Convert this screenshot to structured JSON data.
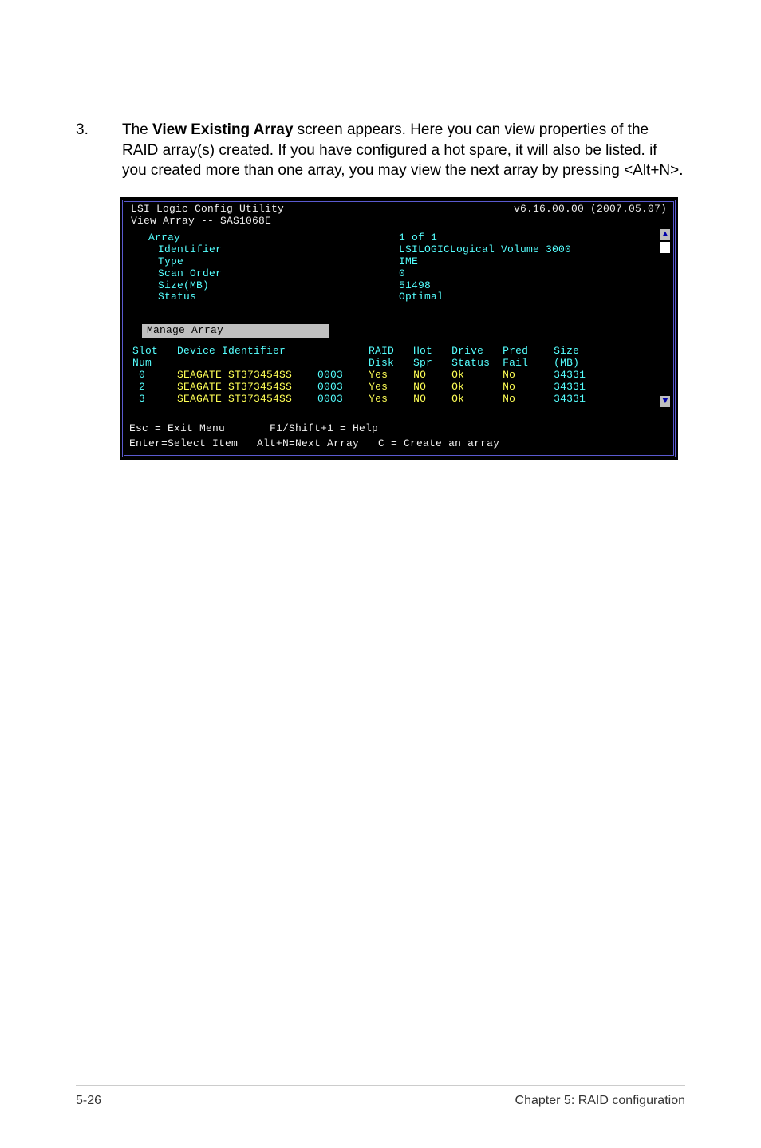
{
  "step": {
    "number": "3.",
    "prefix": "The ",
    "bold": "View Existing Array",
    "suffix": " screen appears. Here you can view properties of the RAID array(s) created. If you have configured a hot spare, it will also be listed. if you created more than one array, you may view the next array by pressing <Alt+N>."
  },
  "terminal": {
    "title_line1": "LSI Logic Config Utility",
    "title_line2": "View Array -- SAS1068E",
    "version": "v6.16.00.00 (2007.05.07)",
    "labels": {
      "array": "Array",
      "identifier": "Identifier",
      "type": "Type",
      "scan_order": "Scan Order",
      "size": "Size(MB)",
      "status": "Status"
    },
    "values": {
      "array": "1 of 1",
      "identifier": "LSILOGICLogical Volume  3000",
      "type": "IME",
      "scan_order": "0",
      "size": "51498",
      "status": "Optimal"
    },
    "selected": "Manage Array",
    "table_header_l1": "Slot   Device Identifier             RAID   Hot   Drive   Pred    Size",
    "table_header_l2": "Num                                  Disk   Spr   Status  Fail    (MB)",
    "rows": [
      {
        "slot": " 0",
        "dev": "SEAGATE ST373454SS",
        "code": "0003",
        "raid": "Yes",
        "hot": "NO",
        "drive": "Ok",
        "pred": "No",
        "size": "  34331"
      },
      {
        "slot": " 2",
        "dev": "SEAGATE ST373454SS",
        "code": "0003",
        "raid": "Yes",
        "hot": "NO",
        "drive": "Ok",
        "pred": "No",
        "size": "  34331"
      },
      {
        "slot": " 3",
        "dev": "SEAGATE ST373454SS",
        "code": "0003",
        "raid": "Yes",
        "hot": "NO",
        "drive": "Ok",
        "pred": "No",
        "size": "  34331"
      }
    ],
    "footer_l1": "Esc = Exit Menu       F1/Shift+1 = Help",
    "footer_l2": "Enter=Select Item   Alt+N=Next Array   C = Create an array"
  },
  "footer": {
    "left": "5-26",
    "right": "Chapter 5: RAID configuration"
  }
}
